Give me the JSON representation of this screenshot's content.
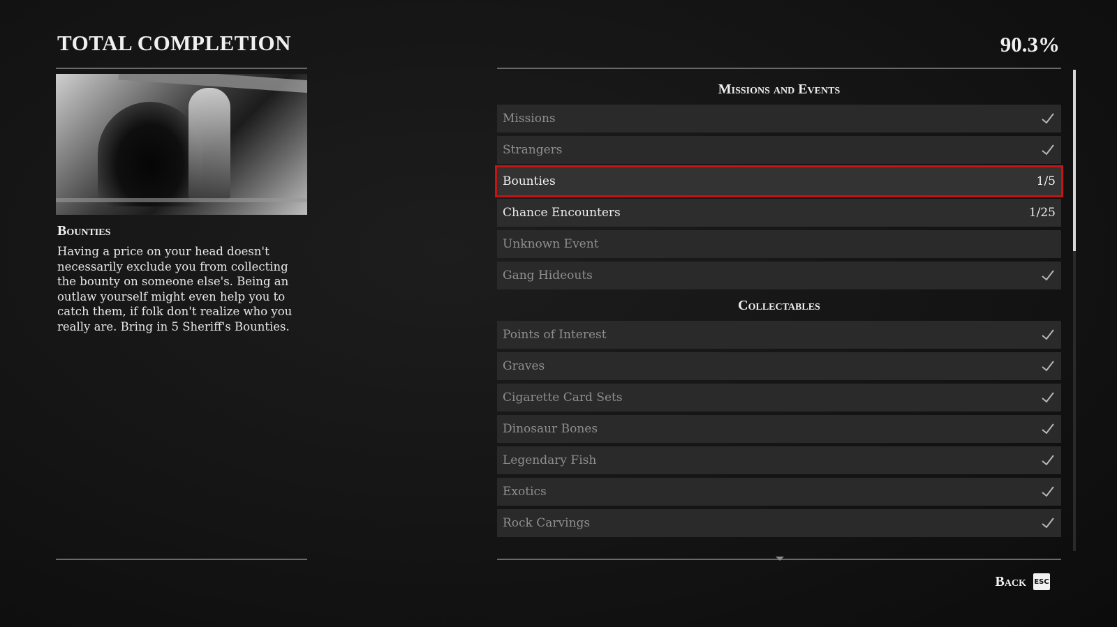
{
  "header": {
    "title": "TOTAL COMPLETION",
    "percent": "90.3%"
  },
  "detail": {
    "heading": "Bounties",
    "description": "Having a price on your head doesn't necessarily exclude you from collecting the bounty on someone else's. Being an outlaw yourself might even help you to catch them, if folk don't realize who you really are. Bring in 5 Sheriff's Bounties."
  },
  "sections": [
    {
      "title": "Missions and Events",
      "rows": [
        {
          "label": "Missions",
          "value": "",
          "status": "complete"
        },
        {
          "label": "Strangers",
          "value": "",
          "status": "complete"
        },
        {
          "label": "Bounties",
          "value": "1/5",
          "status": "selected"
        },
        {
          "label": "Chance Encounters",
          "value": "1/25",
          "status": "active"
        },
        {
          "label": "Unknown Event",
          "value": "",
          "status": "unknown"
        },
        {
          "label": "Gang Hideouts",
          "value": "",
          "status": "complete"
        }
      ]
    },
    {
      "title": "Collectables",
      "rows": [
        {
          "label": "Points of Interest",
          "value": "",
          "status": "complete"
        },
        {
          "label": "Graves",
          "value": "",
          "status": "complete"
        },
        {
          "label": "Cigarette Card Sets",
          "value": "",
          "status": "complete"
        },
        {
          "label": "Dinosaur Bones",
          "value": "",
          "status": "complete"
        },
        {
          "label": "Legendary Fish",
          "value": "",
          "status": "complete"
        },
        {
          "label": "Exotics",
          "value": "",
          "status": "complete"
        },
        {
          "label": "Rock Carvings",
          "value": "",
          "status": "complete"
        }
      ]
    }
  ],
  "footer": {
    "back_label": "Back",
    "back_key": "ESC"
  },
  "icons": {
    "complete": "checkmark-icon"
  }
}
